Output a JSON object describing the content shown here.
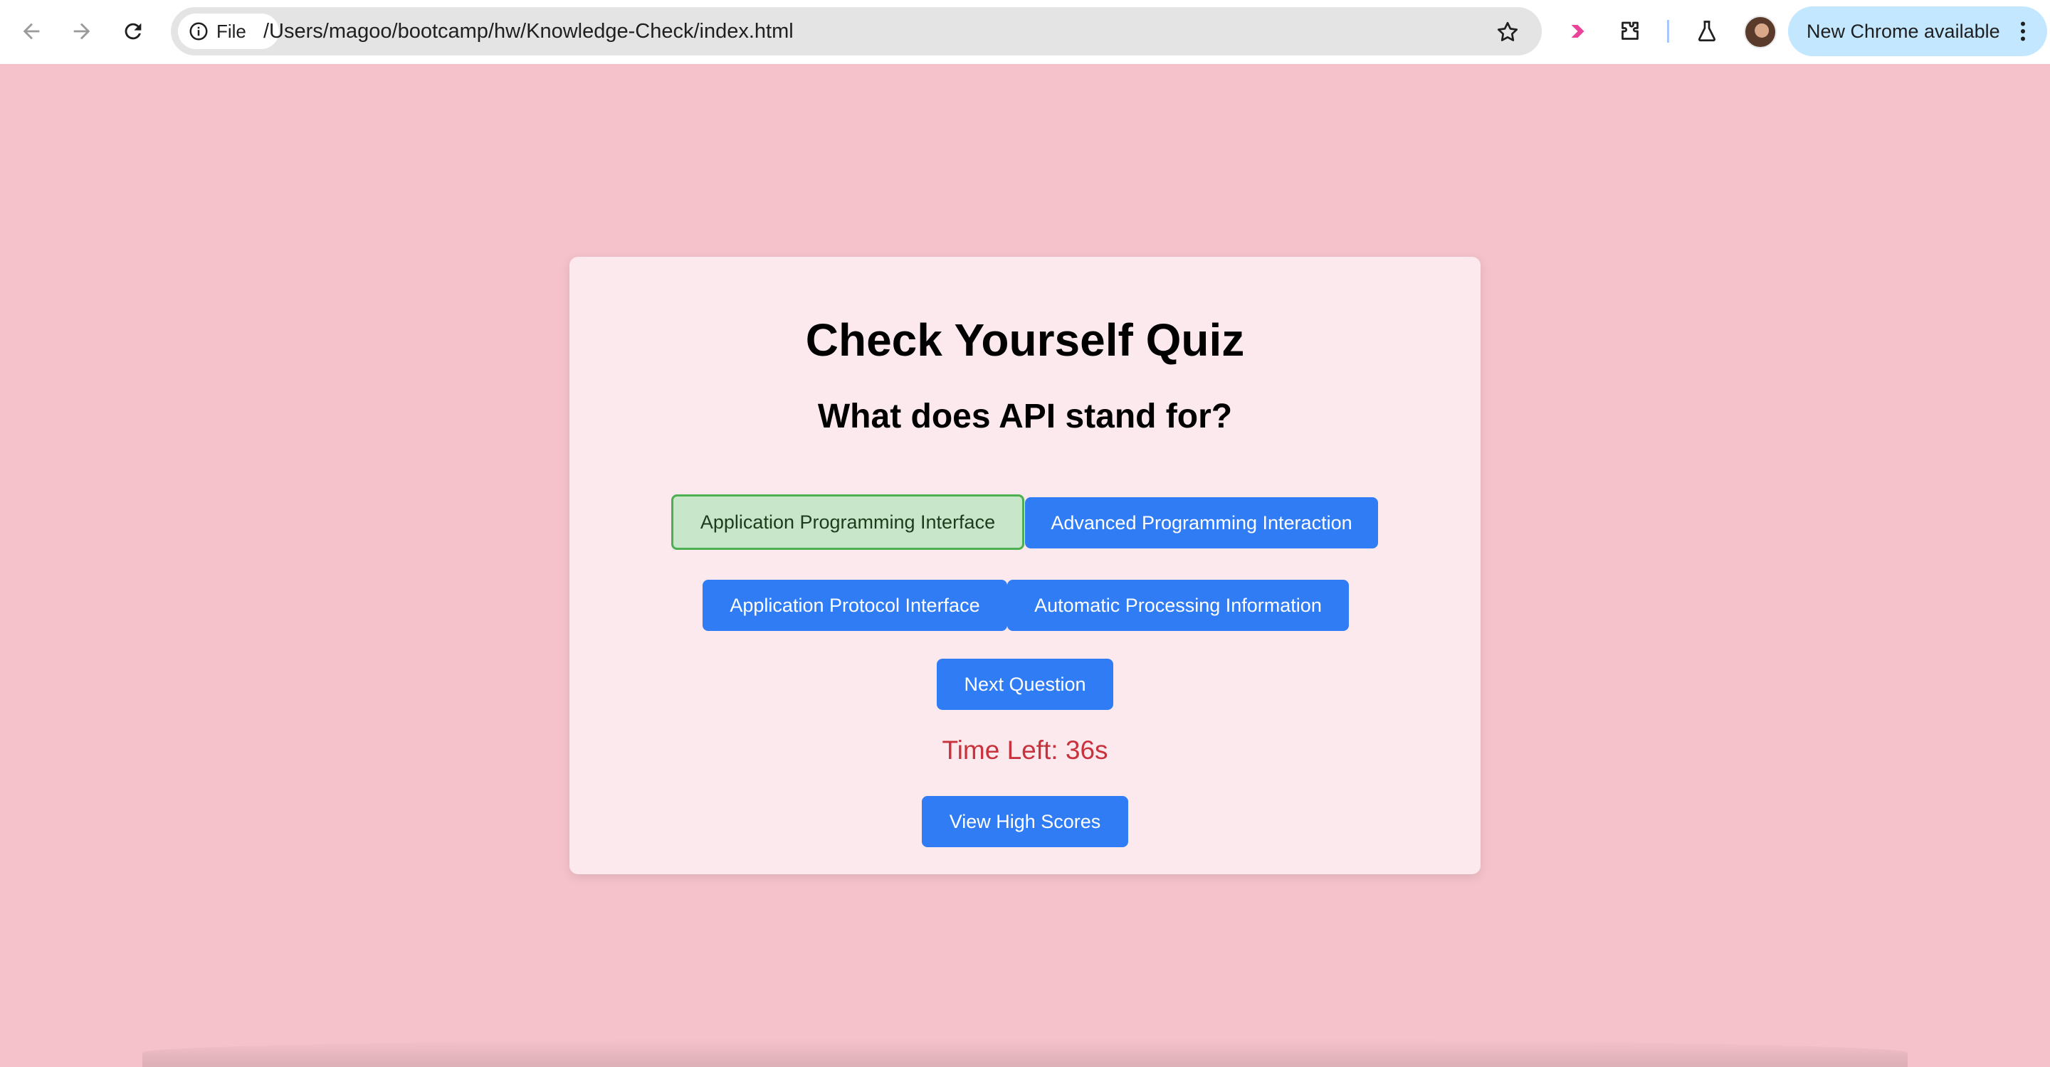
{
  "browser": {
    "site_chip_label": "File",
    "url": "/Users/magoo/bootcamp/hw/Knowledge-Check/index.html",
    "update_label": "New Chrome available"
  },
  "quiz": {
    "title": "Check Yourself Quiz",
    "question": "What does API stand for?",
    "answers": [
      {
        "label": "Application Programming Interface",
        "state": "correct"
      },
      {
        "label": "Advanced Programming Interaction",
        "state": "default"
      },
      {
        "label": "Application Protocol Interface",
        "state": "default"
      },
      {
        "label": "Automatic Processing Information",
        "state": "default"
      }
    ],
    "next_label": "Next Question",
    "timer_text": "Time Left: 36s",
    "high_scores_label": "View High Scores"
  },
  "colors": {
    "page_background": "#f5c2cb",
    "card_background": "#fbe9ed",
    "button_blue": "#2f7cf5",
    "correct_fill": "#c8e6c9",
    "correct_border": "#4caf50",
    "timer_red": "#c8323c"
  }
}
